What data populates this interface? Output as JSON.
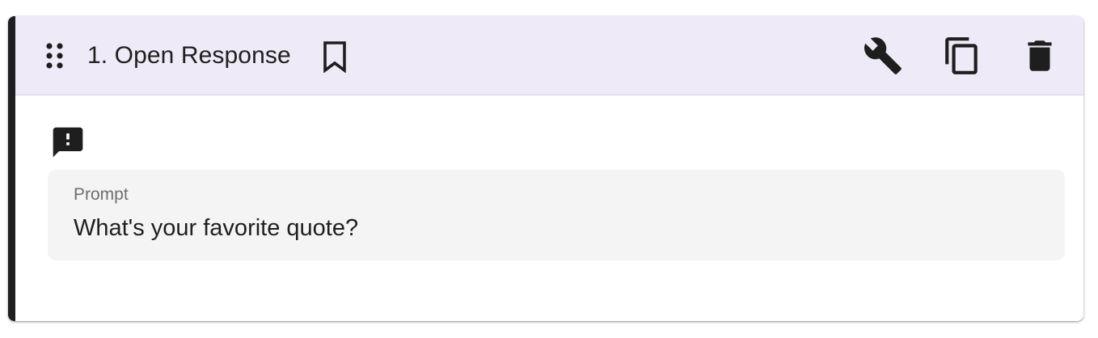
{
  "question": {
    "number_title": "1. Open Response",
    "prompt_label": "Prompt",
    "prompt_text": "What's your favorite quote?"
  },
  "icons": {
    "drag": "drag-handle-icon",
    "bookmark": "bookmark-icon",
    "settings": "wrench-icon",
    "duplicate": "copy-icon",
    "delete": "trash-icon",
    "alert": "feedback-alert-icon"
  },
  "colors": {
    "header_bg": "#eeeaf7",
    "accent_border": "#1e1e1e",
    "prompt_bg": "#f4f4f4",
    "icon": "#1e1e1e"
  }
}
